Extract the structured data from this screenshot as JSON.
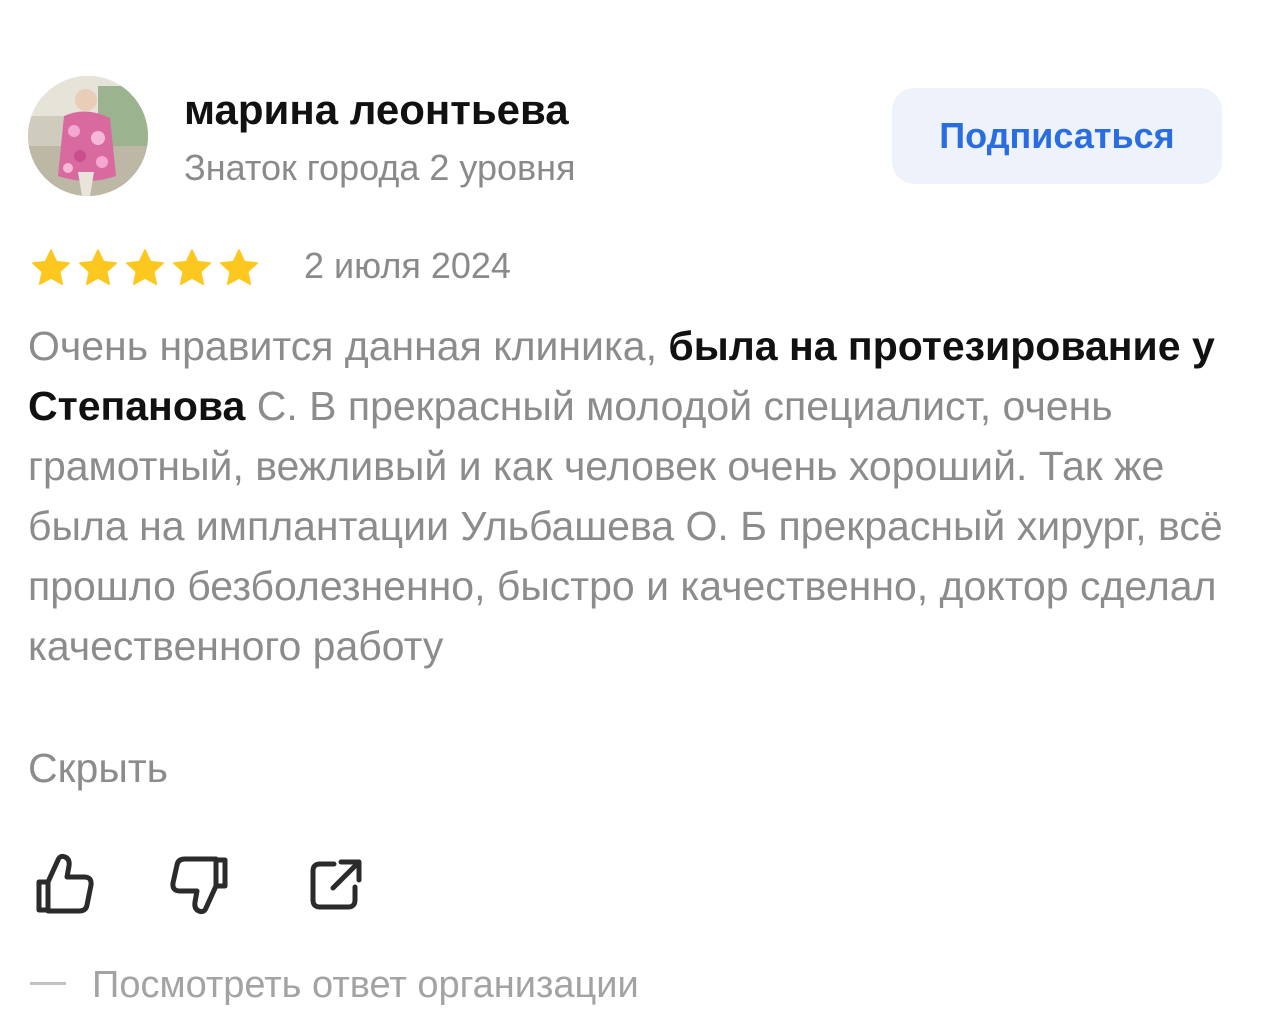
{
  "author": {
    "name": "марина леонтьева",
    "level": "Знаток города 2 уровня",
    "avatar_icon": "user-photo-avatar"
  },
  "subscribe": {
    "label": "Подписаться"
  },
  "review": {
    "rating": 5,
    "rating_max": 5,
    "date": "2 июля 2024",
    "text_part1": "Очень нравится данная клиника, ",
    "text_bold": "была на протезирование у Степанова",
    "text_part2": " С. В прекрасный молодой специалист, очень грамотный, вежливый и как человек очень хороший. Так же была на имплантации Ульбашева О. Б прекрасный хирург, всё прошло безболезненно, быстро и качественно, доктор сделал качественного работу",
    "hide_label": "Скрыть"
  },
  "actions": {
    "like_icon": "thumbs-up-icon",
    "dislike_icon": "thumbs-down-icon",
    "share_icon": "share-icon"
  },
  "org_answer": {
    "label": "Посмотреть ответ организации"
  },
  "colors": {
    "star": "#fcc71e",
    "accent": "#2a6de0",
    "button_bg": "#eef3fb",
    "muted_text": "#8c8c8c",
    "primary_text": "#111111"
  }
}
